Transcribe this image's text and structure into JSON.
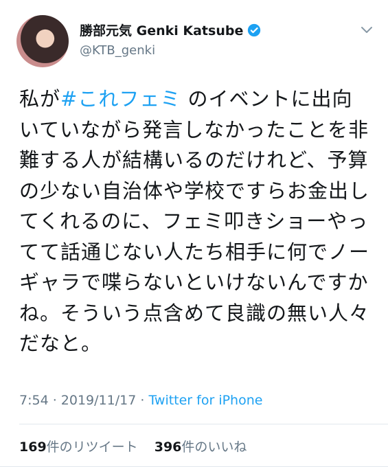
{
  "user": {
    "display_name": "勝部元気 Genki Katsube",
    "handle": "@KTB_genki",
    "verified": true
  },
  "tweet": {
    "text_before": "私が",
    "hashtag": "#これフェミ",
    "text_after": "のイベントに出向いていながら発言しなかったことを非難する人が結構いるのだけれど、予算の少ない自治体や学校ですらお金出してくれるのに、フェミ叩きショーやってて話通じない人たち相手に何でノーギャラで喋らないといけないんですかね。そういう点含めて良識の無い人々だなと。"
  },
  "meta": {
    "time": "7:54",
    "date": "2019/11/17",
    "separator": " · ",
    "source": "Twitter for iPhone"
  },
  "stats": {
    "retweets_count": "169",
    "retweets_label": "件のリツイート",
    "likes_count": "396",
    "likes_label": "件のいいね"
  },
  "colors": {
    "accent": "#1da1f2",
    "text": "#14171a",
    "muted": "#657786"
  },
  "icons": {
    "verified": "verified-badge-icon",
    "menu": "chevron-down-icon"
  }
}
